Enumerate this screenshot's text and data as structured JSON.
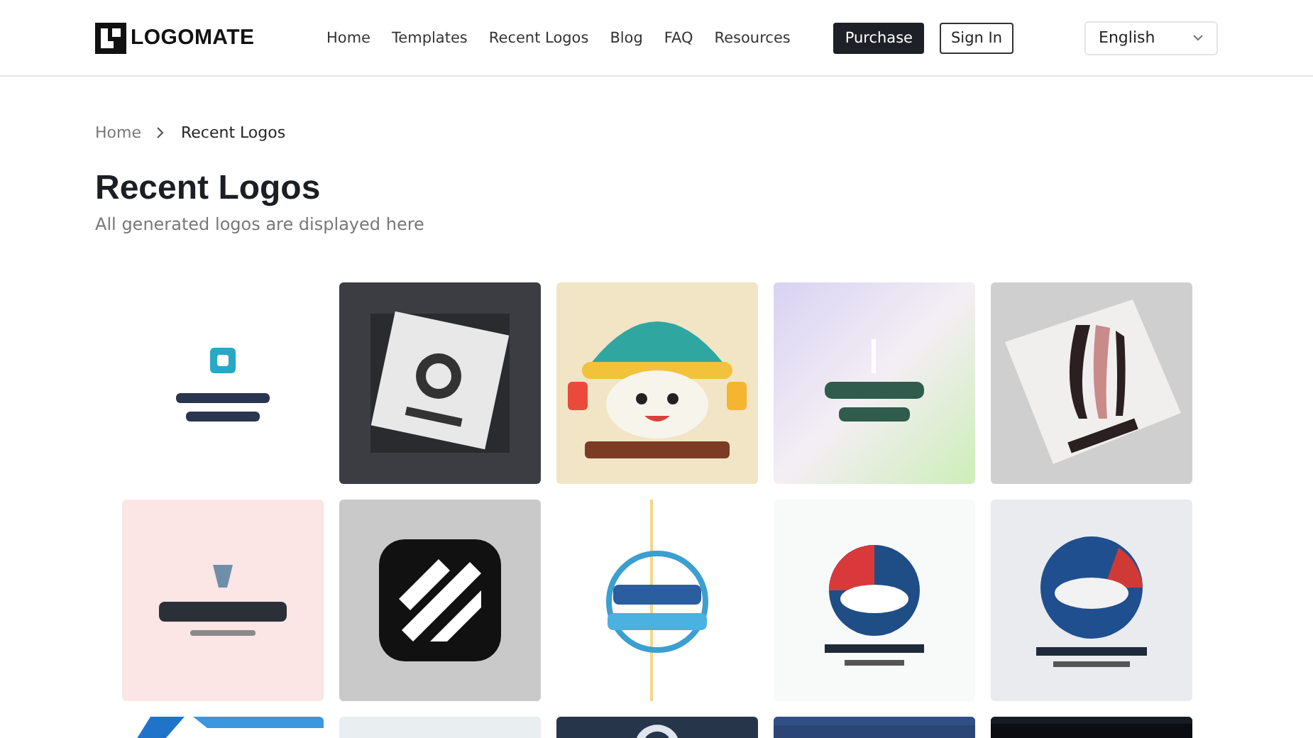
{
  "header": {
    "brand": "LOGOMATE",
    "nav": [
      {
        "label": "Home",
        "selected": false
      },
      {
        "label": "Templates",
        "selected": false
      },
      {
        "label": "Recent Logos",
        "selected": false
      },
      {
        "label": "Blog",
        "selected": false
      },
      {
        "label": "FAQ",
        "selected": false
      },
      {
        "label": "Resources",
        "selected": false
      }
    ],
    "purchase": "Purchase",
    "sign_in": "Sign In",
    "language": {
      "value": "English"
    }
  },
  "breadcrumb": [
    "Home",
    "Recent Logos"
  ],
  "title": "Recent Logos",
  "subtitle": "All generated logos are displayed here"
}
